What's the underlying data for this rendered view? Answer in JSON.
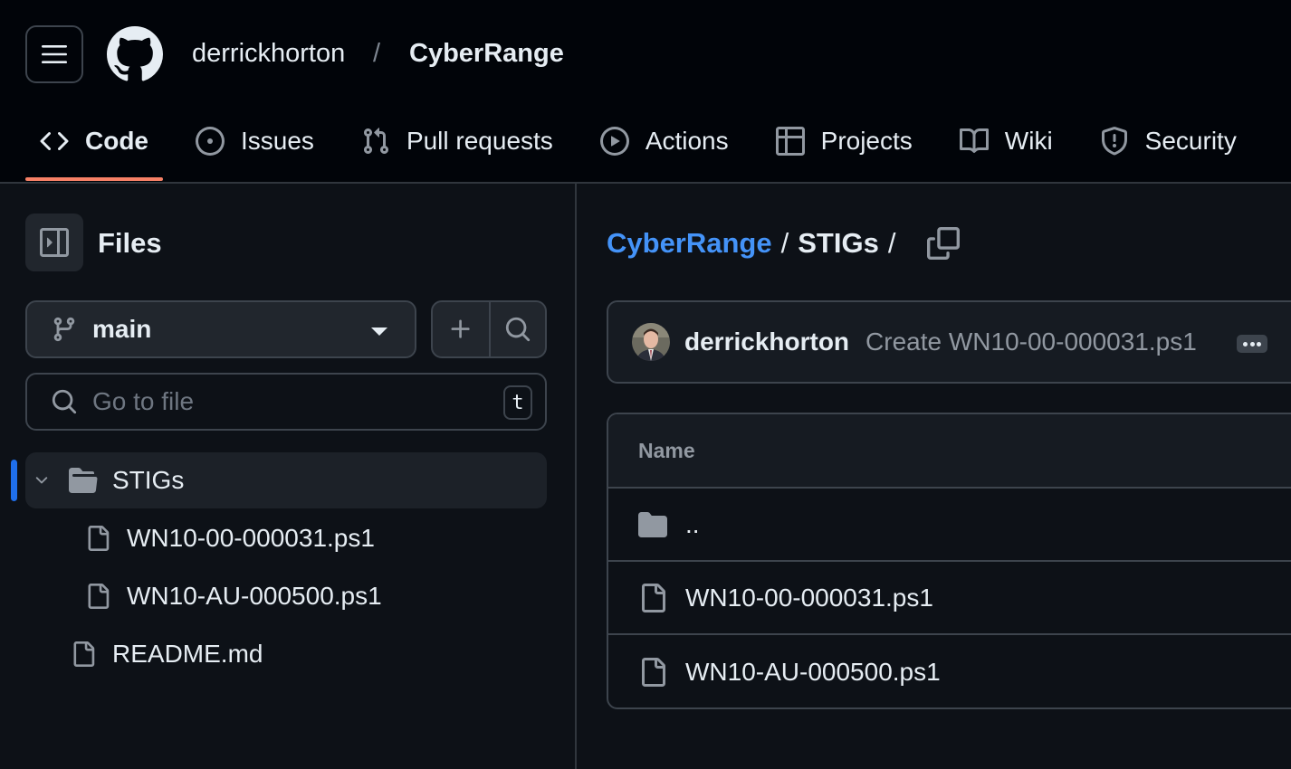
{
  "header": {
    "owner": "derrickhorton",
    "separator": "/",
    "repo": "CyberRange"
  },
  "tabs": [
    {
      "label": "Code",
      "icon": "code-icon",
      "active": true
    },
    {
      "label": "Issues",
      "icon": "issue-opened-icon",
      "active": false
    },
    {
      "label": "Pull requests",
      "icon": "git-pull-request-icon",
      "active": false
    },
    {
      "label": "Actions",
      "icon": "play-icon",
      "active": false
    },
    {
      "label": "Projects",
      "icon": "table-icon",
      "active": false
    },
    {
      "label": "Wiki",
      "icon": "book-icon",
      "active": false
    },
    {
      "label": "Security",
      "icon": "shield-icon",
      "active": false
    }
  ],
  "sidebar": {
    "title": "Files",
    "branch": "main",
    "search_placeholder": "Go to file",
    "search_shortcut": "t",
    "tree": [
      {
        "label": "STIGs",
        "type": "folder",
        "expanded": true,
        "selected": true
      },
      {
        "label": "WN10-00-000031.ps1",
        "type": "file"
      },
      {
        "label": "WN10-AU-000500.ps1",
        "type": "file"
      },
      {
        "label": "README.md",
        "type": "file"
      }
    ]
  },
  "main": {
    "path_root": "CyberRange",
    "path_dir": "STIGs",
    "path_sep": "/",
    "commit": {
      "author": "derrickhorton",
      "message": "Create WN10-00-000031.ps1"
    },
    "table": {
      "header": "Name",
      "rows": [
        {
          "name": "..",
          "type": "parent-folder"
        },
        {
          "name": "WN10-00-000031.ps1",
          "type": "file"
        },
        {
          "name": "WN10-AU-000500.ps1",
          "type": "file"
        }
      ]
    }
  },
  "colors": {
    "background": "#0d1117",
    "header_bg": "#010409",
    "link": "#4493f8",
    "active_tab_underline": "#f78166",
    "selection_bar": "#1f6feb"
  }
}
